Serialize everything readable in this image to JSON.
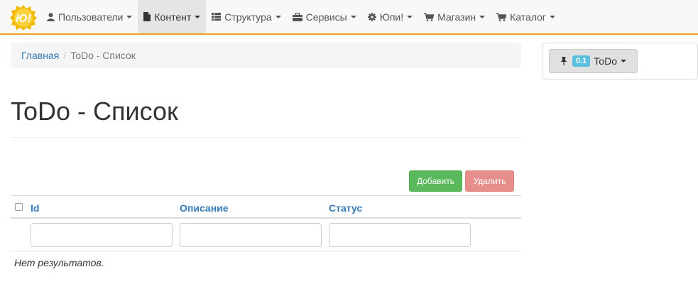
{
  "navbar": {
    "logo_text": "Ю!",
    "items": [
      {
        "label": "Пользователи",
        "icon": "user-icon"
      },
      {
        "label": "Контент",
        "icon": "file-icon",
        "active": true
      },
      {
        "label": "Структура",
        "icon": "list-icon"
      },
      {
        "label": "Сервисы",
        "icon": "briefcase-icon"
      },
      {
        "label": "Юпи!",
        "icon": "gear-icon"
      },
      {
        "label": "Магазин",
        "icon": "cart-icon"
      },
      {
        "label": "Каталог",
        "icon": "cart-icon"
      }
    ]
  },
  "breadcrumb": {
    "home": "Главная",
    "separator": "/",
    "current": "ToDo - Список"
  },
  "side_panel": {
    "version": "0.1",
    "label": "ToDo"
  },
  "page": {
    "title": "ToDo - Список"
  },
  "actions": {
    "add": "Добавить",
    "delete": "Удалить"
  },
  "table": {
    "columns": [
      "Id",
      "Описание",
      "Статус"
    ],
    "filters": [
      "",
      "",
      ""
    ],
    "empty_text": "Нет результатов."
  },
  "colors": {
    "accent": "#f0a01d",
    "link": "#337ab7",
    "success": "#5cb85c",
    "danger": "#d9534f",
    "badge": "#5bc0de"
  }
}
